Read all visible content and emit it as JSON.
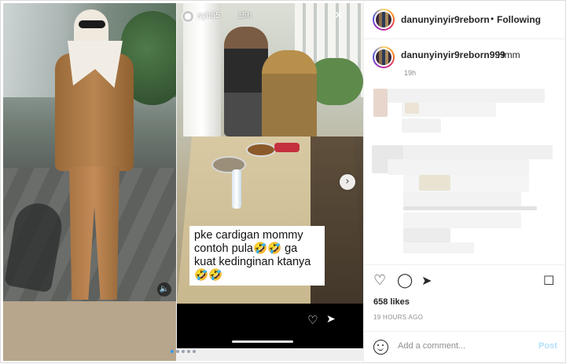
{
  "story": {
    "username": "syh55",
    "time": "15h",
    "caption": "pke cardigan mommy contoh pula🤣🤣 ga kuat kedinginan ktanya🤣🤣"
  },
  "post": {
    "username": "danunyinyir9reborn999",
    "separator": "•",
    "follow_label": "Following",
    "more_icon": "more-options-icon",
    "comment": {
      "username": "danunyinyir9reborn999",
      "text": "Hmm",
      "time": "19h"
    },
    "likes": "658 likes",
    "time_ago": "19 HOURS AGO",
    "add_comment_placeholder": "Add a comment...",
    "post_label": "Post"
  },
  "icons": {
    "like": "heart-icon",
    "comment": "comment-icon",
    "share": "share-icon",
    "save": "bookmark-icon"
  },
  "carousel": {
    "count": 5,
    "active": 1
  },
  "colors": {
    "link_disabled": "#b2dffc",
    "active_dot": "#3897f0"
  }
}
